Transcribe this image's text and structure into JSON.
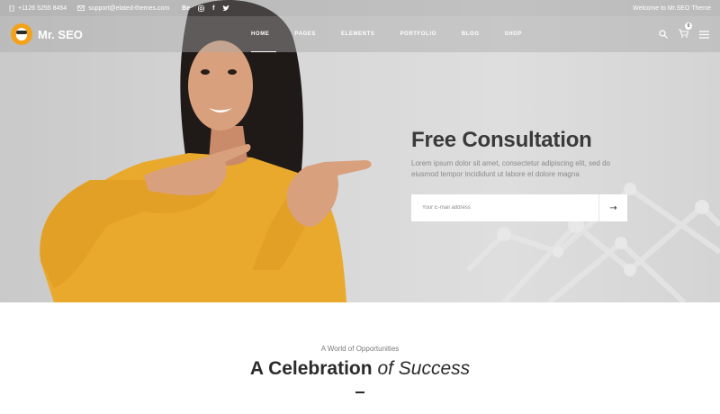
{
  "topbar": {
    "phone": "+1126 5255 8454",
    "email": "support@elated-themes.com",
    "social": [
      "Be",
      "instagram-icon",
      "f",
      "twitter-icon"
    ],
    "welcome": "Welcome to Mr.SEO Theme"
  },
  "header": {
    "logo_text": "Mr. SEO",
    "nav": [
      "HOME",
      "PAGES",
      "ELEMENTS",
      "PORTFOLIO",
      "BLOG",
      "SHOP"
    ],
    "active_nav": "HOME",
    "cart_count": "0"
  },
  "hero": {
    "title": "Free Consultation",
    "text": "Lorem ipsum dolor sit amet, consectetur adipiscing elit, sed do eiusmod tempor incididunt ut labore et dolore magna",
    "email_placeholder": "Your E-mail address",
    "submit_arrow": "→"
  },
  "section": {
    "subtitle": "A World of Opportunities",
    "title_bold": "A Celebration",
    "title_italic": "of Success"
  },
  "colors": {
    "accent": "#f4a21c",
    "sweater": "#e9a92c",
    "text_dark": "#2b2b2b"
  }
}
